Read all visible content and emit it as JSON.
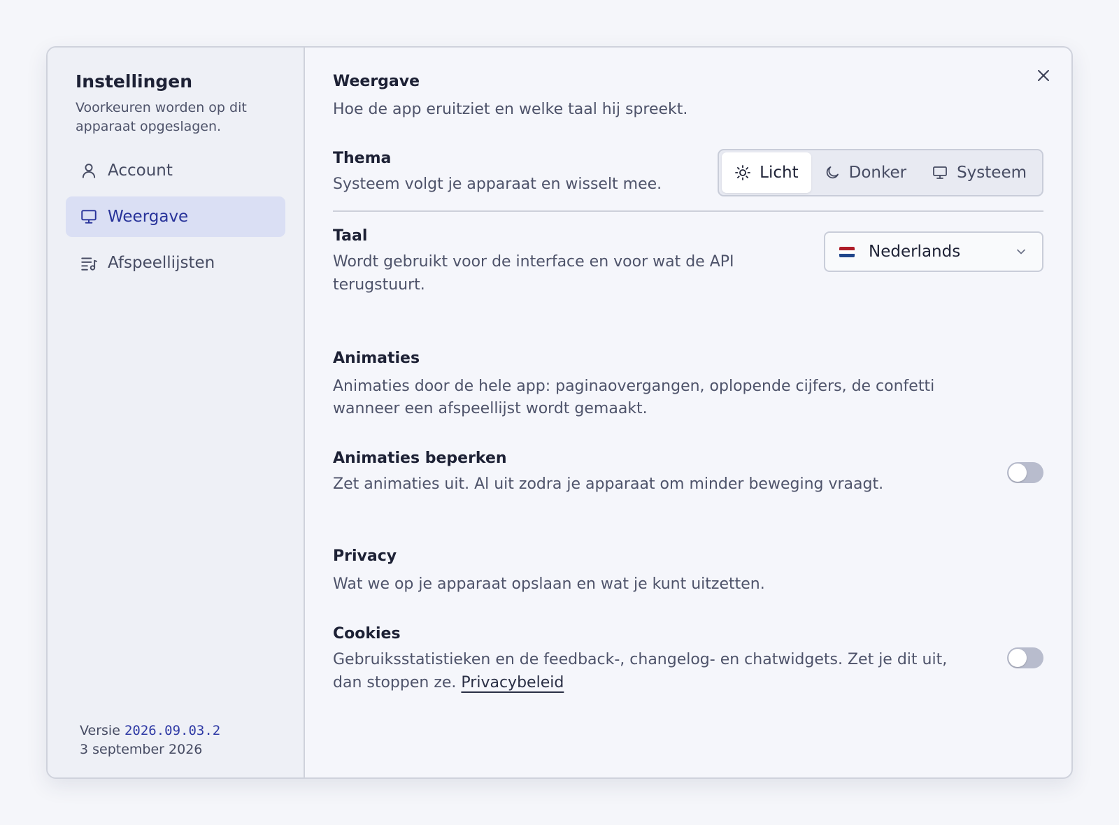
{
  "sidebar": {
    "title": "Instellingen",
    "subtitle": "Voorkeuren worden op dit apparaat opgeslagen.",
    "items": [
      {
        "label": "Account",
        "icon": "user-icon",
        "active": false
      },
      {
        "label": "Weergave",
        "icon": "monitor-icon",
        "active": true
      },
      {
        "label": "Afspeellijsten",
        "icon": "playlist-icon",
        "active": false
      }
    ],
    "version_label": "Versie",
    "version_number": "2026.09.03.2",
    "version_date": "3 september 2026"
  },
  "main": {
    "display_section": {
      "title": "Weergave",
      "description": "Hoe de app eruitziet en welke taal hij spreekt."
    },
    "theme": {
      "label": "Thema",
      "description": "Systeem volgt je apparaat en wisselt mee.",
      "options": [
        {
          "label": "Licht",
          "icon": "sun-icon",
          "selected": true
        },
        {
          "label": "Donker",
          "icon": "moon-icon",
          "selected": false
        },
        {
          "label": "Systeem",
          "icon": "monitor-icon",
          "selected": false
        }
      ]
    },
    "language": {
      "label": "Taal",
      "description": "Wordt gebruikt voor de interface en voor wat de API terugstuurt.",
      "selected": "Nederlands",
      "flag_colors": [
        "#ae1c28",
        "#ffffff",
        "#21468b"
      ]
    },
    "animations_section": {
      "title": "Animaties",
      "description": "Animaties door de hele app: paginaovergangen, oplopende cijfers, de confetti wanneer een afspeellijst wordt gemaakt."
    },
    "reduce_animations": {
      "label": "Animaties beperken",
      "description": "Zet animaties uit. Al uit zodra je apparaat om minder beweging vraagt.",
      "enabled": false
    },
    "privacy_section": {
      "title": "Privacy",
      "description": "Wat we op je apparaat opslaan en wat je kunt uitzetten."
    },
    "cookies": {
      "label": "Cookies",
      "description": "Gebruiksstatistieken en de feedback-, changelog- en chatwidgets. Zet je dit uit, dan stoppen ze.",
      "link": "Privacybeleid",
      "enabled": false
    }
  },
  "colors": {
    "accent": "#2f3aa5",
    "active_nav_bg": "#dadff4",
    "toggle_off": "#b8bccd"
  }
}
